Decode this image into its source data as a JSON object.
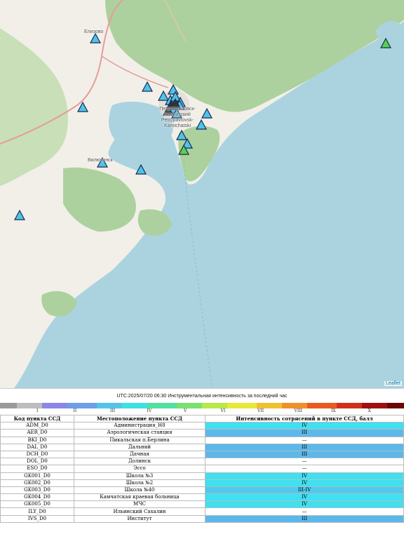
{
  "map": {
    "labels": {
      "city_main": "Петропавловск-Камчатский Petropavlovsk-Kamtchatski",
      "city_elizovo": "Елизово",
      "city_vilyuchinsk": "Вилючинск",
      "attribution": "Leaflet"
    },
    "colors": {
      "sea": "#aad3df",
      "land": "#f2efe9",
      "forest": "#add19e",
      "marker_blue": "#4fc3e8",
      "marker_darkblue": "#8fa8e0",
      "marker_green": "#55d24f"
    },
    "marker_count": 23
  },
  "panel": {
    "title": "UTC:2025/07/20 06:30 Инструментальная интенсивность за последний час",
    "scale_labels": [
      "I",
      "II",
      "III",
      "IV",
      "V",
      "VI",
      "VII",
      "VIII",
      "IX",
      "X",
      "XI"
    ],
    "columns": [
      "Код пункта ССД",
      "Местоположение пункта ССД",
      "Интенсивность сотрясений в пункте ССД, балл"
    ],
    "rows": [
      {
        "code": "ADM_D0",
        "location": "Администрация_Н8",
        "intensity": "IV",
        "color": "#3fe0f0"
      },
      {
        "code": "AER_D0",
        "location": "Аэрологическая станция",
        "intensity": "III",
        "color": "#5bb8ea"
      },
      {
        "code": "BKI_D0",
        "location": "Пикальская п.Берлина",
        "intensity": "—",
        "color": "#ffffff"
      },
      {
        "code": "DAL_D0",
        "location": "Дальний",
        "intensity": "III",
        "color": "#5bb8ea"
      },
      {
        "code": "DCH_D0",
        "location": "Дачная",
        "intensity": "III",
        "color": "#5bb8ea"
      },
      {
        "code": "DOL_D0",
        "location": "Долинск",
        "intensity": "—",
        "color": "#ffffff"
      },
      {
        "code": "ESO_D0",
        "location": "Эссо",
        "intensity": "—",
        "color": "#ffffff"
      },
      {
        "code": "GK001_D0",
        "location": "Школа №3",
        "intensity": "IV",
        "color": "#3fe0f0"
      },
      {
        "code": "GK002_D0",
        "location": "Школа №2",
        "intensity": "IV",
        "color": "#3fe0f0"
      },
      {
        "code": "GK003_D0",
        "location": "Школа №40",
        "intensity": "III-IV",
        "color": "#4dcbee"
      },
      {
        "code": "GK004_D0",
        "location": "Камчатская краевая больница",
        "intensity": "IV",
        "color": "#3fe0f0"
      },
      {
        "code": "GK005_D0",
        "location": "МЧС",
        "intensity": "IV",
        "color": "#3fe0f0"
      },
      {
        "code": "ILY_D0",
        "location": "Ильинский Сахалин",
        "intensity": "—",
        "color": "#ffffff"
      },
      {
        "code": "IVS_D0",
        "location": "Институт",
        "intensity": "III",
        "color": "#5bb8ea"
      }
    ]
  }
}
